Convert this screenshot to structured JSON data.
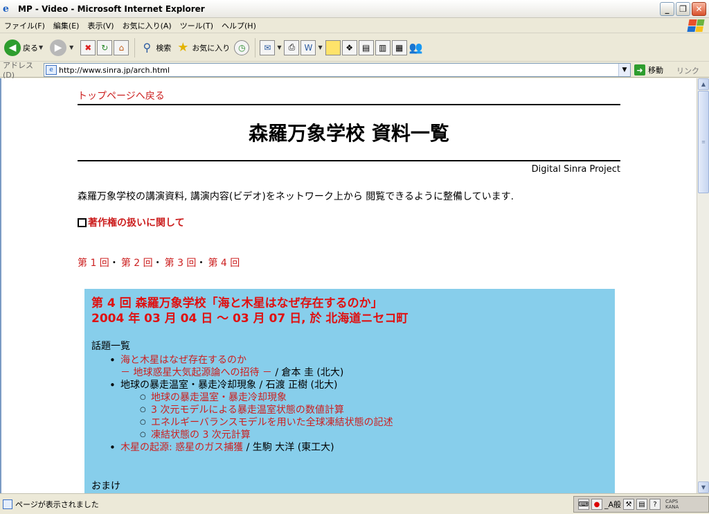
{
  "window": {
    "title": "MP - Video - Microsoft Internet Explorer"
  },
  "menu": [
    "ファイル(F)",
    "編集(E)",
    "表示(V)",
    "お気に入り(A)",
    "ツール(T)",
    "ヘルプ(H)"
  ],
  "toolbar": {
    "back": "戻る",
    "search": "検索",
    "favorites": "お気に入り"
  },
  "address": {
    "label": "アドレス(D)",
    "url": "http://www.sinra.jp/arch.html",
    "go": "移動",
    "links": "リンク"
  },
  "page": {
    "back_link": "トップページへ戻る",
    "title": "森羅万象学校 資料一覧",
    "org": "Digital Sinra Project",
    "intro": "森羅万象学校の講演資料, 講演内容(ビデオ)をネットワーク上から 閲覧できるように整備しています.",
    "copyright": "著作権の扱いに関して",
    "sessions": [
      "第 1 回",
      "第 2 回",
      "第 3 回",
      "第 4 回"
    ],
    "session_sep": "・",
    "panel": {
      "heading1": "第 4 回 森羅万象学校「海と木星はなぜ存在するのか」",
      "heading2": "2004 年 03 月 04 日 ～ 03 月 07 日, 於 北海道ニセコ町",
      "topics_label": "話題一覧",
      "topic1_link": "海と木星はなぜ存在するのか",
      "topic1_sub_link": "－ 地球惑星大気起源論への招待 －",
      "topic1_author": " / 倉本 圭 (北大)",
      "topic2_text": "地球の暴走温室・暴走冷却現象 / 石渡 正樹 (北大)",
      "topic2_subs": [
        "地球の暴走温室・暴走冷却現象",
        "3 次元モデルによる暴走温室状態の数値計算",
        "エネルギーバランスモデルを用いた全球凍結状態の記述",
        "凍結状態の 3 次元計算"
      ],
      "topic3_link": "木星の起源: 惑星のガス捕獲",
      "topic3_author": " / 生駒 大洋 (東工大)",
      "omake": "おまけ"
    }
  },
  "status": {
    "text": "ページが表示されました",
    "ime_mode": "_A般",
    "caps": "CAPS",
    "kana": "KANA"
  }
}
